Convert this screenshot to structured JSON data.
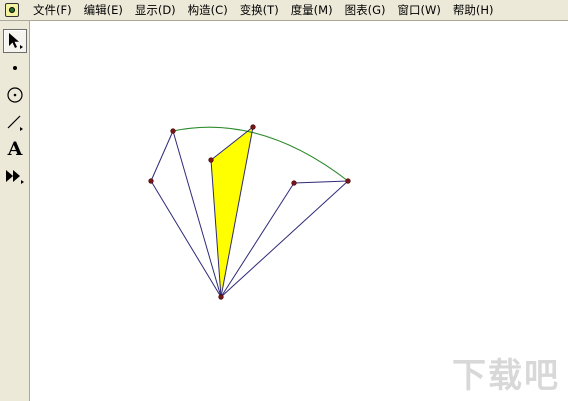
{
  "menu": {
    "items": [
      {
        "label": "文件(F)"
      },
      {
        "label": "编辑(E)"
      },
      {
        "label": "显示(D)"
      },
      {
        "label": "构造(C)"
      },
      {
        "label": "变换(T)"
      },
      {
        "label": "度量(M)"
      },
      {
        "label": "图表(G)"
      },
      {
        "label": "窗口(W)"
      },
      {
        "label": "帮助(H)"
      }
    ]
  },
  "toolbox": {
    "tools": [
      {
        "name": "arrow-select-tool",
        "icon": "arrow-icon",
        "active": true
      },
      {
        "name": "point-tool",
        "icon": "point-icon",
        "active": false
      },
      {
        "name": "compass-tool",
        "icon": "circle-icon",
        "active": false
      },
      {
        "name": "straightedge-tool",
        "icon": "line-icon",
        "active": false
      },
      {
        "name": "text-tool",
        "icon": "text-a-icon",
        "active": false
      },
      {
        "name": "custom-tool",
        "icon": "double-arrow-icon",
        "active": false
      }
    ],
    "text_tool_glyph": "A"
  },
  "colors": {
    "menubar_bg": "#ece9d8",
    "segment": "#2e2a78",
    "arc": "#2e8b2e",
    "point": "#7a1616",
    "fill": "#ffff00"
  },
  "watermark": {
    "text": "下载吧"
  }
}
